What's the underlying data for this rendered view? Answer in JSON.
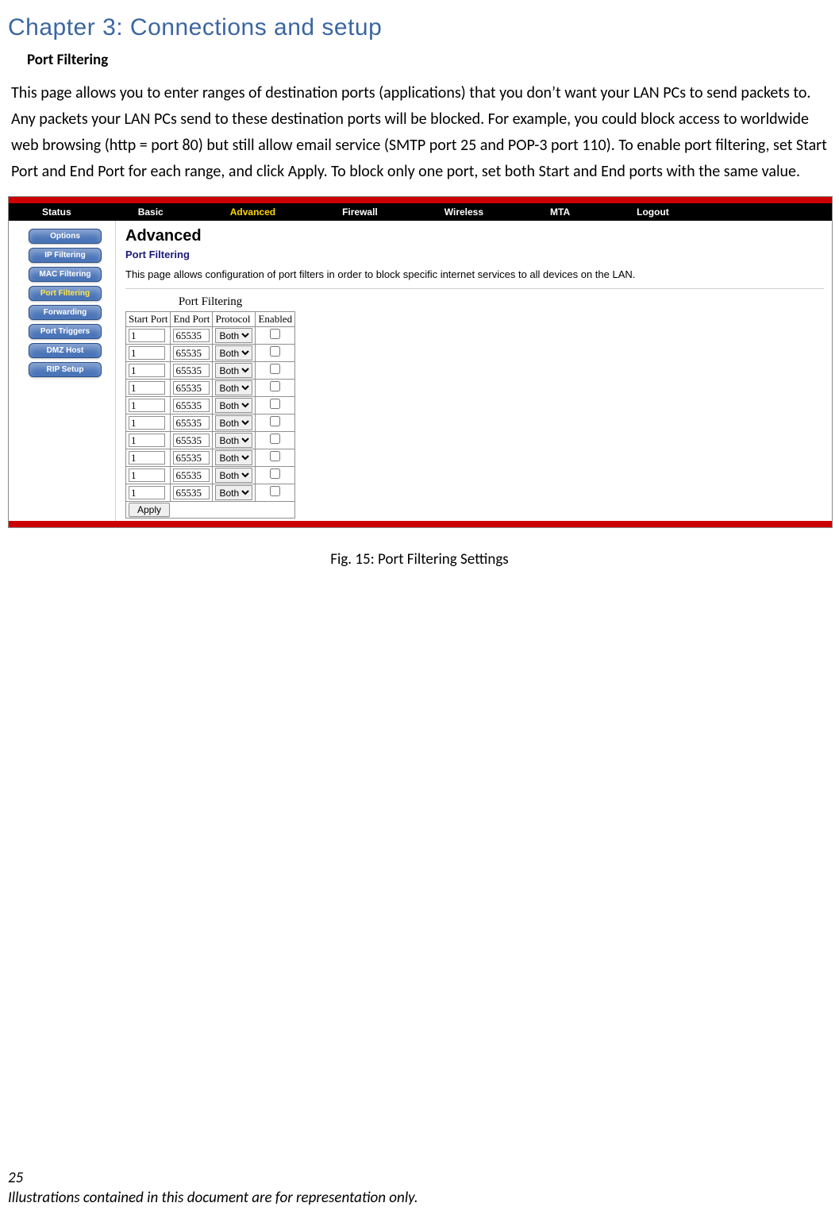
{
  "chapter_title": "Chapter 3: Connections and setup",
  "section_title": "Port Filtering",
  "body_text": "This page allows you to enter ranges of destination ports (applications) that you don’t want your LAN PCs to send packets to. Any packets your LAN PCs send to these destination ports will be blocked. For example, you could block access to worldwide web browsing (http = port 80) but still allow email service (SMTP port 25 and POP-3 port 110). To enable port filtering, set Start Port and End Port for each range, and click Apply. To block only one port, set both Start and End ports with the same value.",
  "tabs": [
    "Status",
    "Basic",
    "Advanced",
    "Firewall",
    "Wireless",
    "MTA",
    "Logout"
  ],
  "active_tab": "Advanced",
  "sidebar": {
    "items": [
      "Options",
      "IP Filtering",
      "MAC Filtering",
      "Port Filtering",
      "Forwarding",
      "Port Triggers",
      "DMZ Host",
      "RIP Setup"
    ],
    "active": "Port Filtering"
  },
  "panel": {
    "title": "Advanced",
    "subtitle": "Port Filtering",
    "description": "This page allows configuration of port filters in order to block specific internet services to all devices on the LAN."
  },
  "table": {
    "caption": "Port Filtering",
    "headers": [
      "Start Port",
      "End Port",
      "Protocol",
      "Enabled"
    ],
    "rows": [
      {
        "start": "1",
        "end": "65535",
        "protocol": "Both",
        "enabled": false
      },
      {
        "start": "1",
        "end": "65535",
        "protocol": "Both",
        "enabled": false
      },
      {
        "start": "1",
        "end": "65535",
        "protocol": "Both",
        "enabled": false
      },
      {
        "start": "1",
        "end": "65535",
        "protocol": "Both",
        "enabled": false
      },
      {
        "start": "1",
        "end": "65535",
        "protocol": "Both",
        "enabled": false
      },
      {
        "start": "1",
        "end": "65535",
        "protocol": "Both",
        "enabled": false
      },
      {
        "start": "1",
        "end": "65535",
        "protocol": "Both",
        "enabled": false
      },
      {
        "start": "1",
        "end": "65535",
        "protocol": "Both",
        "enabled": false
      },
      {
        "start": "1",
        "end": "65535",
        "protocol": "Both",
        "enabled": false
      },
      {
        "start": "1",
        "end": "65535",
        "protocol": "Both",
        "enabled": false
      }
    ],
    "apply_label": "Apply"
  },
  "figure_caption": "Fig. 15: Port Filtering Settings",
  "footer": {
    "page_number": "25",
    "note": "Illustrations contained in this document are for representation only."
  }
}
